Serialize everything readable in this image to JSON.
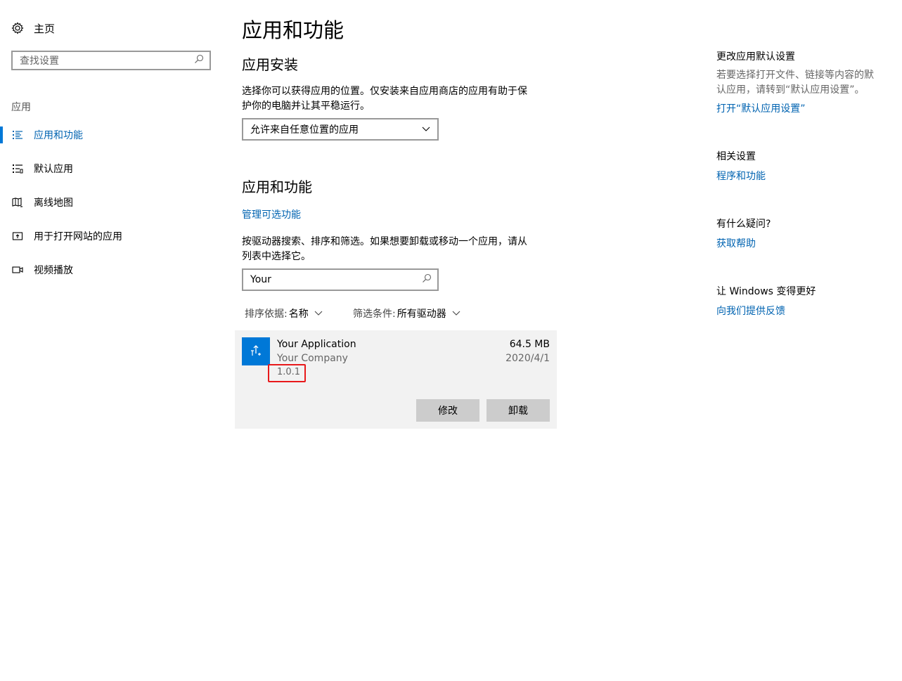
{
  "sidebar": {
    "home_label": "主页",
    "search_placeholder": "查找设置",
    "section_label": "应用",
    "items": [
      {
        "label": "应用和功能",
        "icon": "apps-features-icon",
        "active": true
      },
      {
        "label": "默认应用",
        "icon": "default-apps-icon",
        "active": false
      },
      {
        "label": "离线地图",
        "icon": "offline-maps-icon",
        "active": false
      },
      {
        "label": "用于打开网站的应用",
        "icon": "apps-for-websites-icon",
        "active": false
      },
      {
        "label": "视频播放",
        "icon": "video-playback-icon",
        "active": false
      }
    ]
  },
  "main": {
    "title": "应用和功能",
    "install_heading": "应用安装",
    "install_desc_line1": "选择你可以获得应用的位置。仅安装来自应用商店的应用有助于保",
    "install_desc_line2": "护你的电脑并让其平稳运行。",
    "install_dropdown_value": "允许来自任意位置的应用",
    "apps_heading": "应用和功能",
    "manage_optional_link": "管理可选功能",
    "search_desc_line1": "按驱动器搜索、排序和筛选。如果想要卸载或移动一个应用，请从",
    "search_desc_line2": "列表中选择它。",
    "search_value": "Your",
    "sort_label": "排序依据:",
    "sort_value": "名称",
    "filter_label": "筛选条件:",
    "filter_value": "所有驱动器",
    "app": {
      "name": "Your Application",
      "company": "Your Company",
      "version": "1.0.1",
      "size": "64.5 MB",
      "date": "2020/4/1",
      "modify_label": "修改",
      "uninstall_label": "卸载"
    }
  },
  "right": {
    "default_apps_heading": "更改应用默认设置",
    "default_apps_desc_line1": "若要选择打开文件、链接等内容的默",
    "default_apps_desc_line2": "认应用，请转到“默认应用设置”。",
    "default_apps_link": "打开“默认应用设置”",
    "related_heading": "相关设置",
    "programs_link": "程序和功能",
    "question_heading": "有什么疑问?",
    "help_link": "获取帮助",
    "better_heading": "让 Windows 变得更好",
    "feedback_link": "向我们提供反馈"
  },
  "colors": {
    "accent": "#0078d7",
    "link": "#0063b1",
    "highlight_box": "#e8191b",
    "card_bg": "#f2f2f2",
    "button_bg": "#cccccc"
  }
}
